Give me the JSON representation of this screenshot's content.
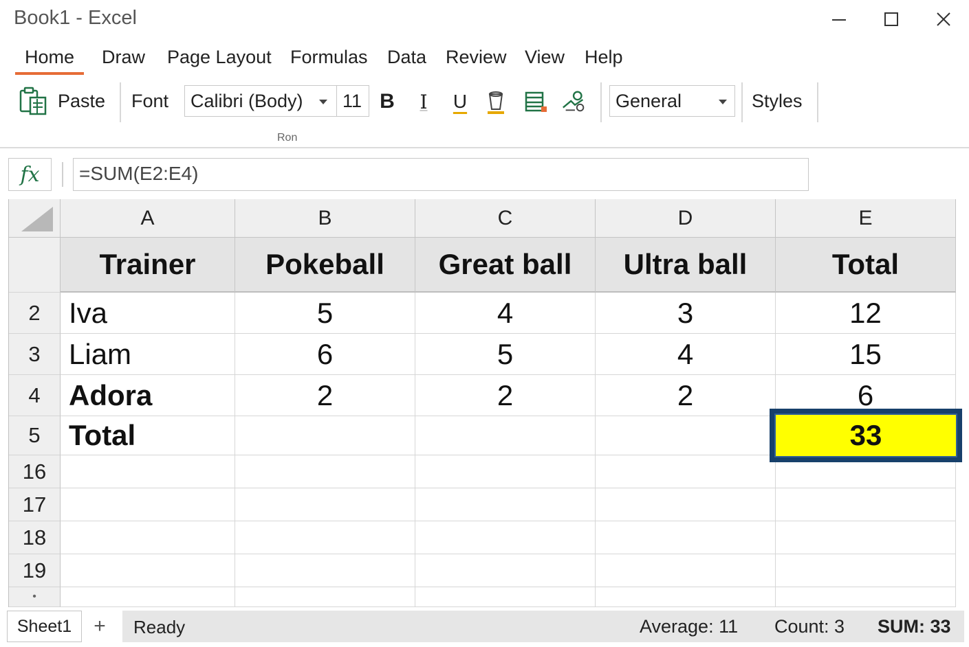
{
  "window": {
    "title": "Book1 - Excel",
    "minimize_icon": "minimize-icon",
    "maximize_icon": "maximize-icon",
    "close_icon": "close-icon"
  },
  "menu": {
    "tabs": [
      "Home",
      "Draw",
      "Page Layout",
      "Formulas",
      "Data",
      "Review",
      "View",
      "Help"
    ],
    "active": "Home"
  },
  "ribbon": {
    "paste_label": "Paste",
    "font_label": "Font",
    "font_name": "Calibri (Body)",
    "font_size": "11",
    "bold": "B",
    "italic": "I",
    "underline": "U",
    "number_format": "General",
    "styles_label": "Styles",
    "group_label": "Ron"
  },
  "formula_bar": {
    "fx": "fx",
    "formula": "=SUM(E2:E4)"
  },
  "sheet": {
    "columns": [
      "A",
      "B",
      "C",
      "D",
      "E"
    ],
    "header_row": [
      "Trainer",
      "Pokeball",
      "Great ball",
      "Ultra ball",
      "Total"
    ],
    "rows": [
      {
        "num": "2",
        "cells": [
          "Iva",
          "5",
          "4",
          "3",
          "12"
        ]
      },
      {
        "num": "3",
        "cells": [
          "Liam",
          "6",
          "5",
          "4",
          "15"
        ]
      },
      {
        "num": "4",
        "cells": [
          "Adora",
          "2",
          "2",
          "2",
          "6"
        ]
      },
      {
        "num": "5",
        "cells": [
          "Total",
          "",
          "",
          "",
          "33"
        ]
      }
    ],
    "empty_rows": [
      "16",
      "17",
      "18",
      "19"
    ],
    "selected_cell": "E5"
  },
  "bottom": {
    "sheet_tab": "Sheet1",
    "add_sheet": "+",
    "status": "Ready",
    "average": "Average: 11",
    "count": "Count: 3",
    "sum": "SUM: 33"
  },
  "colors": {
    "accent": "#e66c37",
    "selected_fill": "#ffff00",
    "selected_border": "#17406b",
    "excel_green": "#217346"
  }
}
